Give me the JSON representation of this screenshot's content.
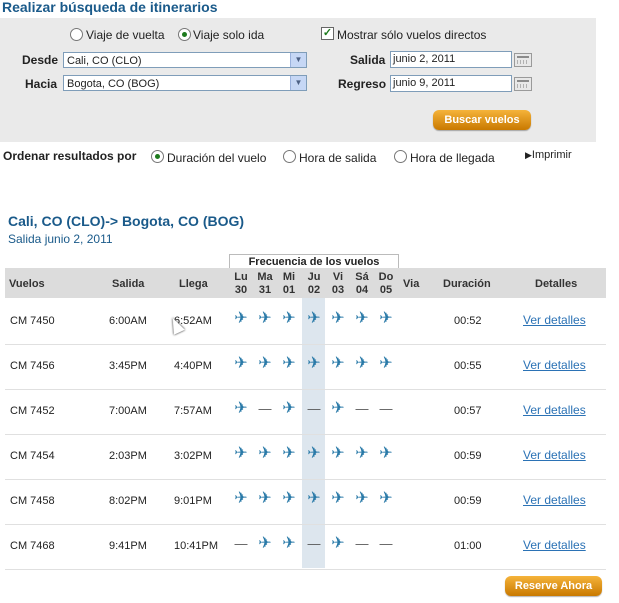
{
  "page_title": "Realizar búsqueda de itinerarios",
  "search": {
    "trip_round_label": "Viaje de vuelta",
    "trip_oneway_label": "Viaje solo ida",
    "direct_only_label": "Mostrar sólo vuelos directos",
    "direct_only_checked": true,
    "from_label": "Desde",
    "from_value": "Cali, CO (CLO)",
    "to_label": "Hacia",
    "to_value": "Bogota, CO (BOG)",
    "depart_label": "Salida",
    "depart_value": "junio 2, 2011",
    "return_label": "Regreso",
    "return_value": "junio 9, 2011",
    "search_button": "Buscar vuelos"
  },
  "sort": {
    "label": "Ordenar resultados por",
    "options": [
      "Duración del vuelo",
      "Hora de salida",
      "Hora de llegada"
    ],
    "selected": "Duración del vuelo",
    "print_label": "Imprimir"
  },
  "route": {
    "title": "Cali, CO (CLO)-> Bogota, CO (BOG)",
    "subtitle": "Salida junio 2, 2011"
  },
  "table": {
    "frequency_title": "Frecuencia de los vuelos",
    "headers": {
      "flights": "Vuelos",
      "depart": "Salida",
      "arrive": "Llega",
      "via": "Via",
      "duration": "Duración",
      "details": "Detalles"
    },
    "days": [
      {
        "name": "Lu",
        "num": "30"
      },
      {
        "name": "Ma",
        "num": "31"
      },
      {
        "name": "Mi",
        "num": "01"
      },
      {
        "name": "Ju",
        "num": "02"
      },
      {
        "name": "Vi",
        "num": "03"
      },
      {
        "name": "Sá",
        "num": "04"
      },
      {
        "name": "Do",
        "num": "05"
      }
    ],
    "rows": [
      {
        "flight": "CM 7450",
        "depart": "6:00AM",
        "arrive": "6:52AM",
        "days": [
          1,
          1,
          1,
          1,
          1,
          1,
          1
        ],
        "duration": "00:52",
        "details": "Ver detalles"
      },
      {
        "flight": "CM 7456",
        "depart": "3:45PM",
        "arrive": "4:40PM",
        "days": [
          1,
          1,
          1,
          1,
          1,
          1,
          1
        ],
        "duration": "00:55",
        "details": "Ver detalles"
      },
      {
        "flight": "CM 7452",
        "depart": "7:00AM",
        "arrive": "7:57AM",
        "days": [
          1,
          0,
          1,
          0,
          1,
          0,
          0
        ],
        "duration": "00:57",
        "details": "Ver detalles"
      },
      {
        "flight": "CM 7454",
        "depart": "2:03PM",
        "arrive": "3:02PM",
        "days": [
          1,
          1,
          1,
          1,
          1,
          1,
          1
        ],
        "duration": "00:59",
        "details": "Ver detalles"
      },
      {
        "flight": "CM 7458",
        "depart": "8:02PM",
        "arrive": "9:01PM",
        "days": [
          1,
          1,
          1,
          1,
          1,
          1,
          1
        ],
        "duration": "00:59",
        "details": "Ver detalles"
      },
      {
        "flight": "CM 7468",
        "depart": "9:41PM",
        "arrive": "10:41PM",
        "days": [
          0,
          1,
          1,
          0,
          1,
          0,
          0
        ],
        "duration": "01:00",
        "details": "Ver detalles"
      }
    ],
    "reserve_button": "Reserve Ahora"
  },
  "colors": {
    "accent_blue": "#1a5a8a",
    "link_blue": "#2b72b5",
    "button_gold": "#e09a1a"
  }
}
